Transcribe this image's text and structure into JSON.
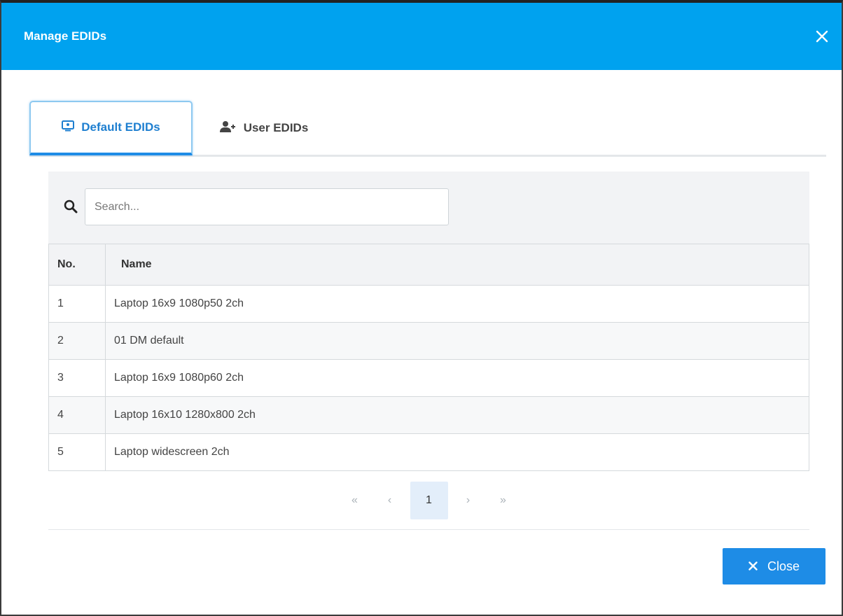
{
  "dialog": {
    "title": "Manage EDIDs"
  },
  "tabs": [
    {
      "label": "Default EDIDs",
      "icon": "monitor-icon",
      "active": true
    },
    {
      "label": "User EDIDs",
      "icon": "user-plus-icon",
      "active": false
    }
  ],
  "search": {
    "placeholder": "Search...",
    "value": ""
  },
  "table": {
    "columns": [
      "No.",
      "Name"
    ],
    "rows": [
      {
        "no": "1",
        "name": "Laptop 16x9 1080p50 2ch"
      },
      {
        "no": "2",
        "name": "01 DM default"
      },
      {
        "no": "3",
        "name": "Laptop 16x9 1080p60 2ch"
      },
      {
        "no": "4",
        "name": "Laptop 16x10 1280x800 2ch"
      },
      {
        "no": "5",
        "name": "Laptop widescreen 2ch"
      }
    ]
  },
  "pagination": {
    "first": "«",
    "prev": "‹",
    "current_page": "1",
    "next": "›",
    "last": "»"
  },
  "footer": {
    "close_label": "Close"
  },
  "colors": {
    "header": "#00a2ef",
    "accent": "#1e8ce6"
  }
}
